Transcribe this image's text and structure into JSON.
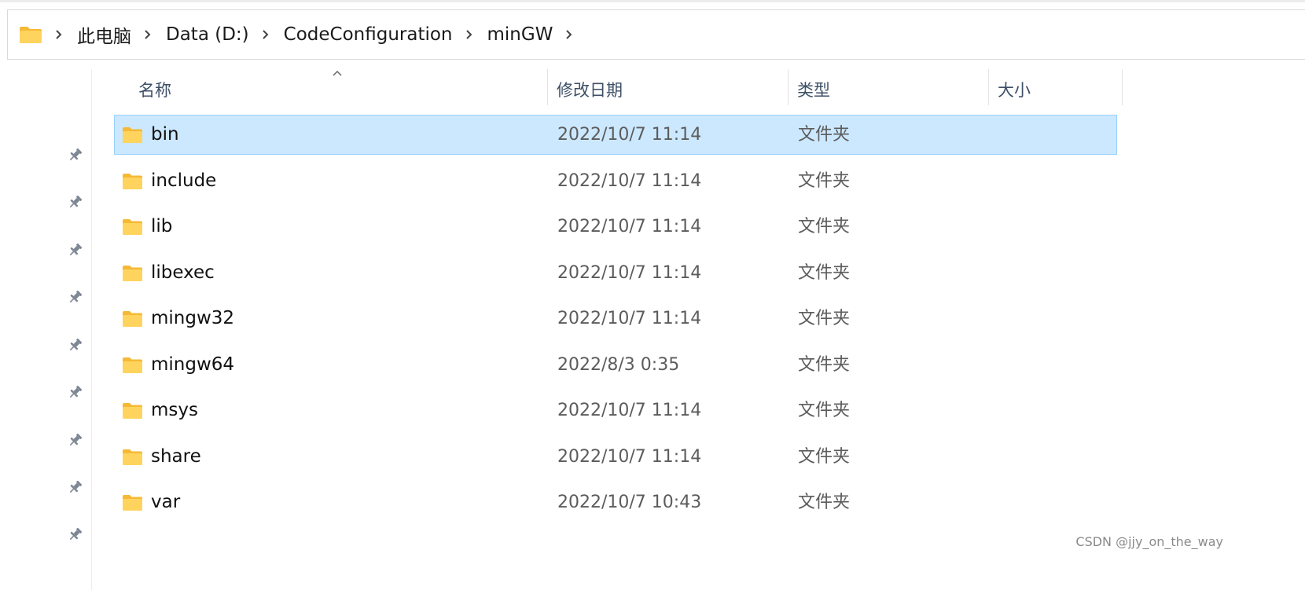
{
  "breadcrumb": {
    "items": [
      "此电脑",
      "Data (D:)",
      "CodeConfiguration",
      "minGW"
    ],
    "root_icon": "folder-icon",
    "separator_icon": "chevron-right-icon"
  },
  "columns": {
    "name": "名称",
    "date": "修改日期",
    "type": "类型",
    "size": "大小"
  },
  "sort": {
    "column": "name",
    "direction": "ascending",
    "icon": "sort-up-caret-icon"
  },
  "files": [
    {
      "name": "bin",
      "date": "2022/10/7 11:14",
      "type": "文件夹",
      "size": "",
      "selected": true
    },
    {
      "name": "include",
      "date": "2022/10/7 11:14",
      "type": "文件夹",
      "size": "",
      "selected": false
    },
    {
      "name": "lib",
      "date": "2022/10/7 11:14",
      "type": "文件夹",
      "size": "",
      "selected": false
    },
    {
      "name": "libexec",
      "date": "2022/10/7 11:14",
      "type": "文件夹",
      "size": "",
      "selected": false
    },
    {
      "name": "mingw32",
      "date": "2022/10/7 11:14",
      "type": "文件夹",
      "size": "",
      "selected": false
    },
    {
      "name": "mingw64",
      "date": "2022/8/3 0:35",
      "type": "文件夹",
      "size": "",
      "selected": false
    },
    {
      "name": "msys",
      "date": "2022/10/7 11:14",
      "type": "文件夹",
      "size": "",
      "selected": false
    },
    {
      "name": "share",
      "date": "2022/10/7 11:14",
      "type": "文件夹",
      "size": "",
      "selected": false
    },
    {
      "name": "var",
      "date": "2022/10/7 10:43",
      "type": "文件夹",
      "size": "",
      "selected": false
    }
  ],
  "nav_pane": {
    "pinned_count": 9,
    "pin_icon": "pin-icon"
  },
  "watermark": "CSDN @jjy_on_the_way",
  "colors": {
    "selection_bg": "#cce8ff",
    "selection_border": "#99d1ff",
    "header_text": "#3d4f66",
    "folder_yellow": "#ffd05b"
  }
}
